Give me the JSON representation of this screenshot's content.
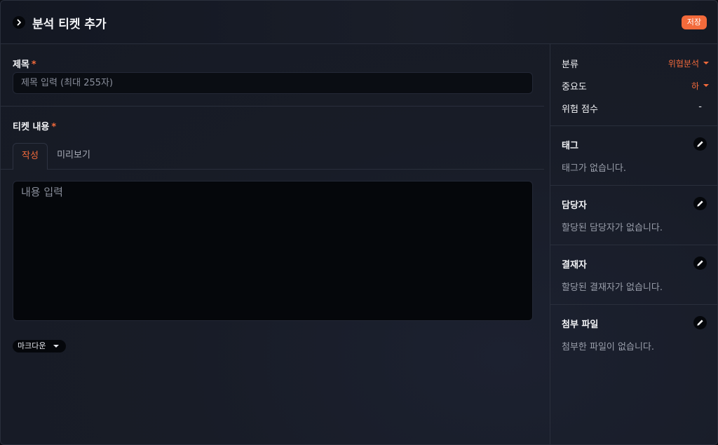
{
  "header": {
    "title": "분석 티켓 추가",
    "save_label": "저장"
  },
  "form": {
    "title_label": "제목",
    "required_mark": "*",
    "title_placeholder": "제목 입력 (최대 255자)",
    "content_label": "티켓 내용",
    "tabs": [
      {
        "label": "작성",
        "active": true
      },
      {
        "label": "미리보기",
        "active": false
      }
    ],
    "content_placeholder": "내용 입력",
    "format_selected": "마크다운"
  },
  "sidebar": {
    "properties": [
      {
        "label": "분류",
        "value": "위협분석"
      },
      {
        "label": "중요도",
        "value": "하"
      },
      {
        "label": "위험 점수",
        "value": "-"
      }
    ],
    "sections": [
      {
        "title": "태그",
        "empty_text": "태그가 없습니다."
      },
      {
        "title": "담당자",
        "empty_text": "할당된 담당자가 없습니다."
      },
      {
        "title": "결재자",
        "empty_text": "할당된 결재자가 없습니다."
      },
      {
        "title": "첨부 파일",
        "empty_text": "첨부한 파일이 없습니다."
      }
    ]
  },
  "icons": {
    "collapse": "chevron-right-icon",
    "edit": "pencil-icon",
    "dropdown": "caret-down-icon"
  },
  "colors": {
    "accent": "#f26a3b",
    "background": "#181c27",
    "input_bg": "#0a0d13"
  }
}
